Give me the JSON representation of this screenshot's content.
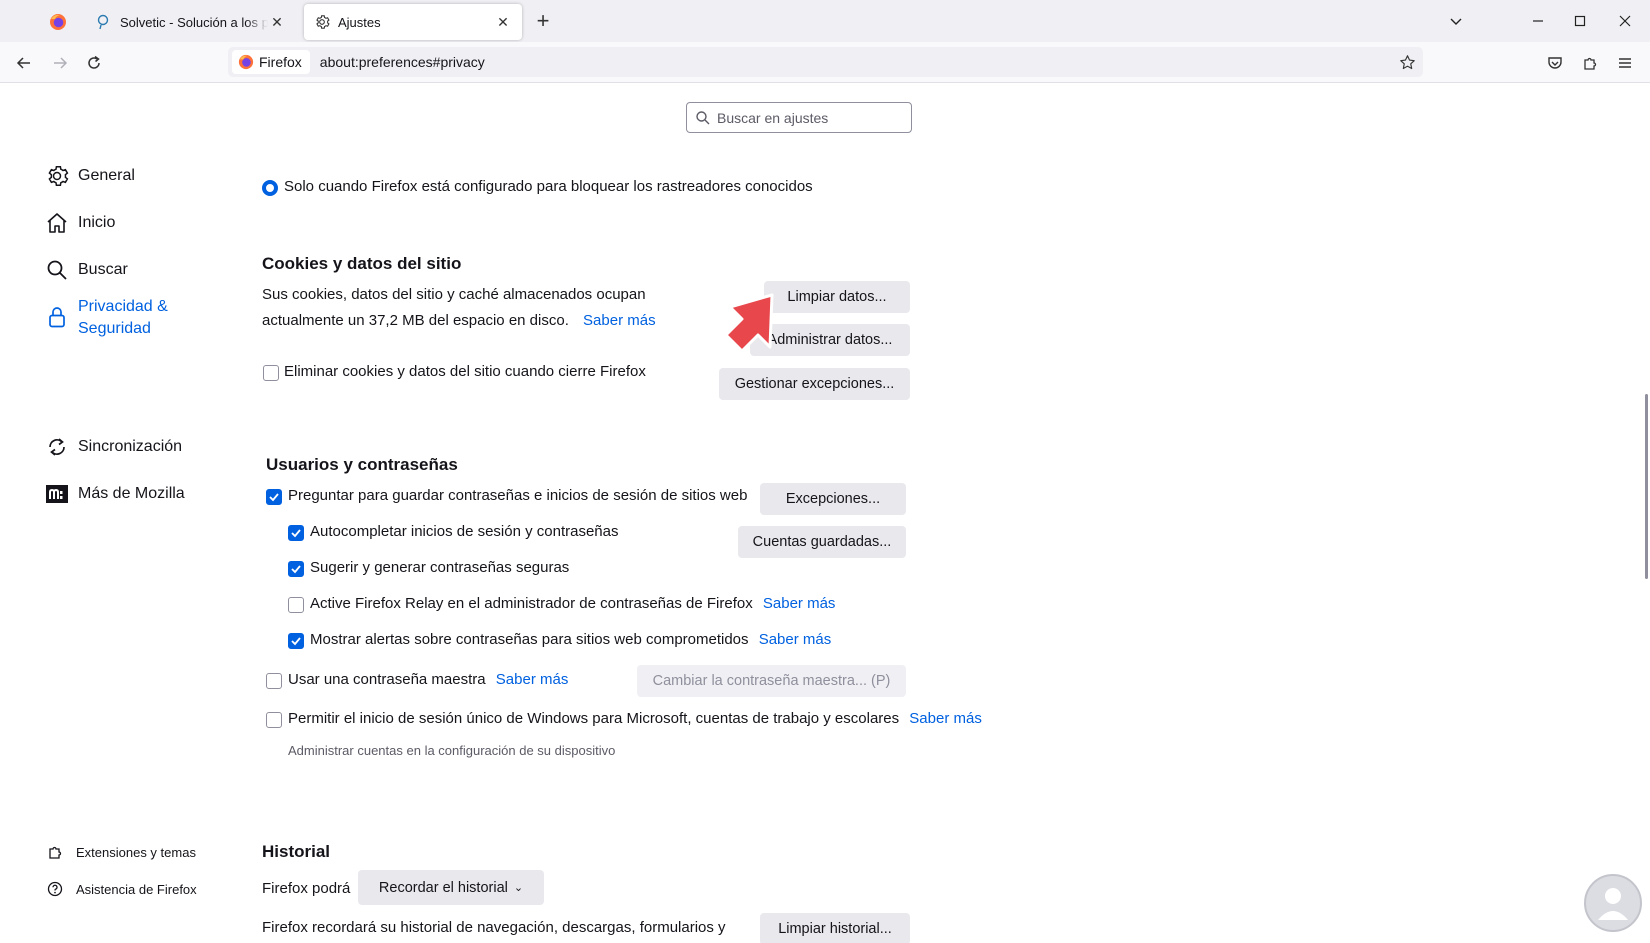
{
  "tabs": [
    {
      "label": "Solvetic - Solución a los problem"
    },
    {
      "label": "Ajustes"
    }
  ],
  "navbar": {
    "identity": "Firefox",
    "url": "about:preferences#privacy"
  },
  "search": {
    "placeholder": "Buscar en ajustes"
  },
  "sidebar": {
    "items": [
      {
        "label": "General"
      },
      {
        "label": "Inicio"
      },
      {
        "label": "Buscar"
      },
      {
        "label": "Privacidad & Seguridad"
      },
      {
        "label": "Sincronización"
      },
      {
        "label": "Más de Mozilla"
      }
    ],
    "footer": [
      {
        "label": "Extensiones y temas"
      },
      {
        "label": "Asistencia de Firefox"
      }
    ]
  },
  "tracking": {
    "radio_label": "Solo cuando Firefox está configurado para bloquear los rastreadores conocidos"
  },
  "cookies": {
    "heading": "Cookies y datos del sitio",
    "desc_line1": "Sus cookies, datos del sitio y caché almacenados ocupan",
    "desc_line2": "actualmente un 37,2 MB del espacio en disco.",
    "learn_more": "Saber más",
    "clear_button": "Limpiar datos...",
    "manage_button": "Administrar datos...",
    "exceptions_button": "Gestionar excepciones...",
    "delete_on_close": "Eliminar cookies y datos del sitio cuando cierre Firefox"
  },
  "logins": {
    "heading": "Usuarios y contraseñas",
    "ask_save": "Preguntar para guardar contraseñas e inicios de sesión de sitios web",
    "exceptions_button": "Excepciones...",
    "autofill": "Autocompletar inicios de sesión y contraseñas",
    "saved_button": "Cuentas guardadas...",
    "suggest": "Sugerir y generar contraseñas seguras",
    "relay": "Active Firefox Relay en el administrador de contraseñas de Firefox",
    "relay_link": "Saber más",
    "breach": "Mostrar alertas sobre contraseñas para sitios web comprometidos",
    "breach_link": "Saber más",
    "primary_pw": "Usar una contraseña maestra",
    "primary_link": "Saber más",
    "change_pw_button": "Cambiar la contraseña maestra... (P)",
    "windows_sso": "Permitir el inicio de sesión único de Windows para Microsoft, cuentas de trabajo y escolares",
    "windows_sso_link": "Saber más",
    "windows_sso_desc": "Administrar cuentas en la configuración de su dispositivo"
  },
  "history": {
    "heading": "Historial",
    "firefox_will": "Firefox podrá",
    "mode_select": "Recordar el historial",
    "desc": "Firefox recordará su historial de navegación, descargas, formularios y",
    "clear_button": "Limpiar historial..."
  },
  "colors": {
    "accent": "#0061e0",
    "arrow": "#e8474b"
  }
}
